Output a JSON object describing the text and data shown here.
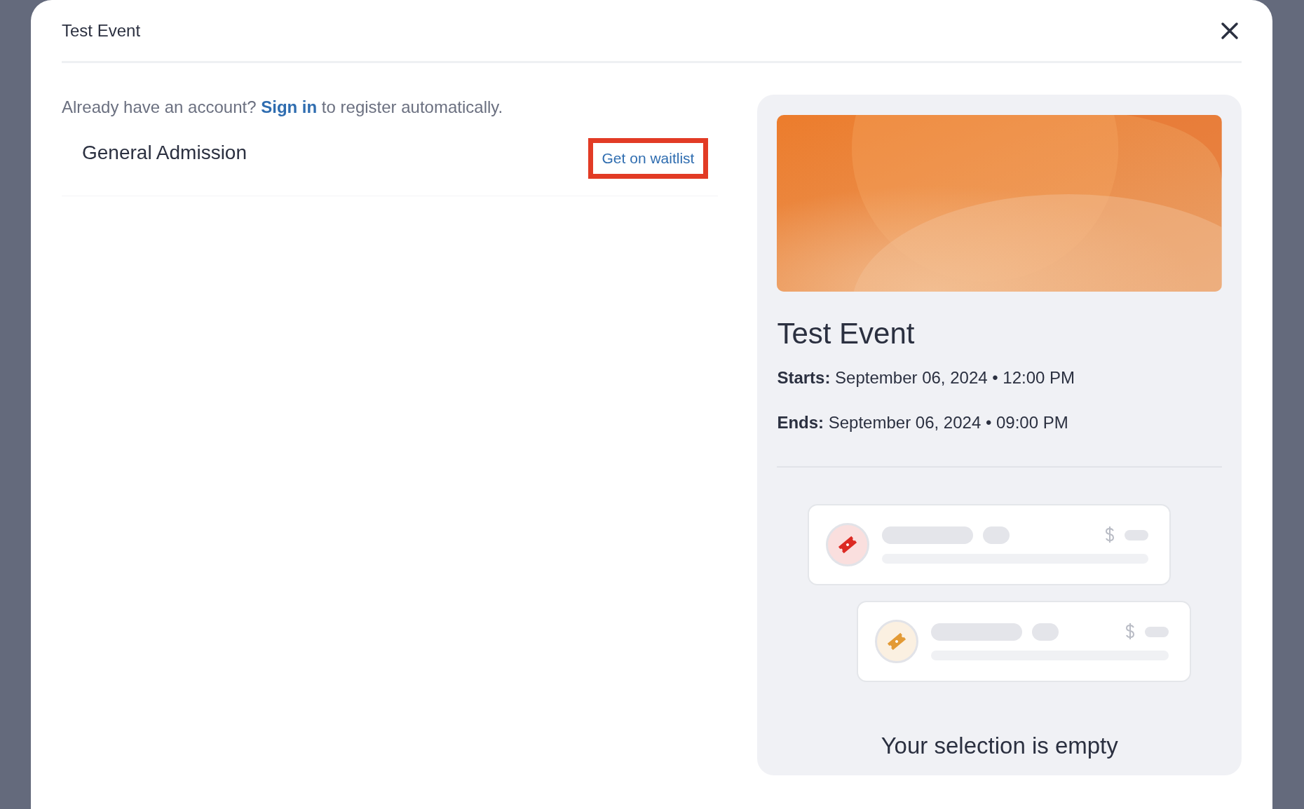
{
  "modal": {
    "title": "Test Event"
  },
  "signin_prompt": {
    "before": "Already have an account?",
    "link": "Sign in",
    "after": "to register automatically."
  },
  "tickets": [
    {
      "name": "General Admission",
      "action": {
        "label": "Get on waitlist",
        "highlighted": true
      }
    }
  ],
  "summary": {
    "title": "Test Event",
    "dates": [
      {
        "label": "Starts:",
        "value": "September 06, 2024 • 12:00 PM"
      },
      {
        "label": "Ends:",
        "value": "September 06, 2024 • 09:00 PM"
      }
    ],
    "placeholder_cards": [
      {
        "color": "#dc2a23"
      },
      {
        "color": "#e39a35"
      }
    ],
    "empty_message": "Your selection is empty"
  }
}
